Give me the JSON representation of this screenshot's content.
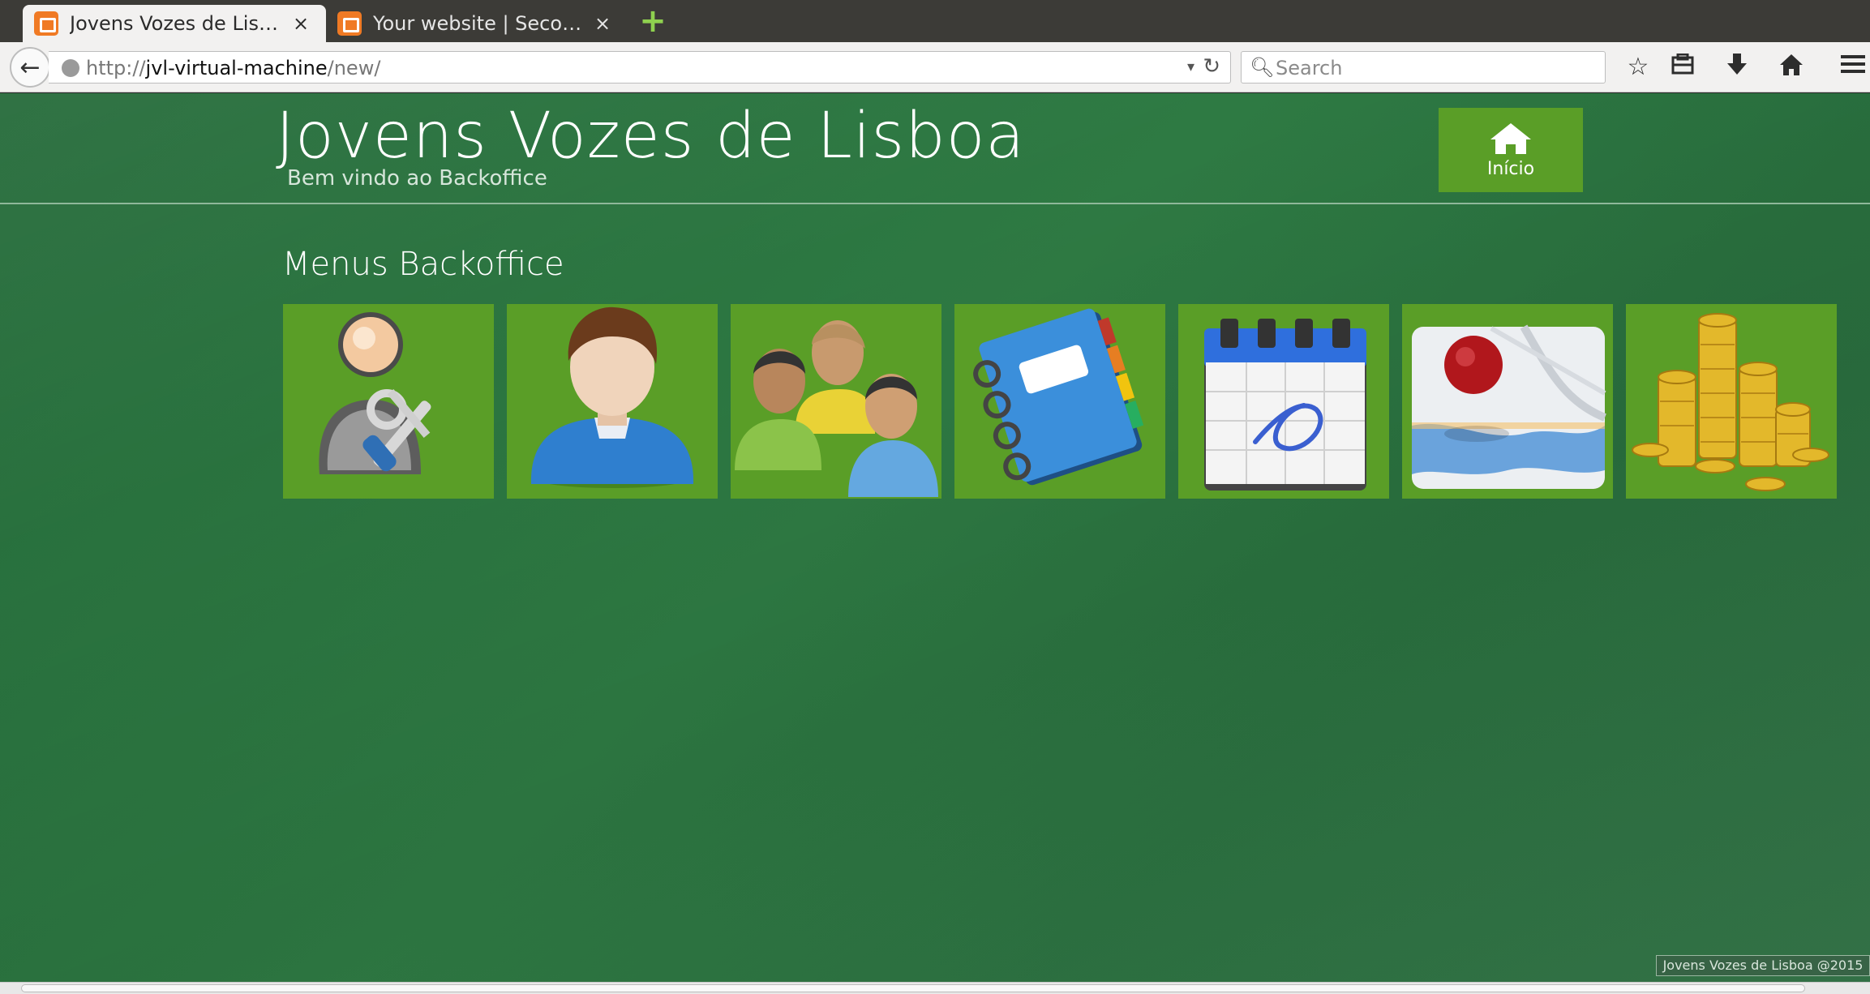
{
  "browser": {
    "tabs": [
      {
        "title": "Jovens Vozes de Lis…",
        "close": "×"
      },
      {
        "title": "Your website | Seco…",
        "close": "×"
      }
    ],
    "new_tab": "+",
    "url": {
      "scheme": "http://",
      "host": "jvl-virtual-machine",
      "path": "/new/"
    },
    "search_placeholder": "Search",
    "icons": [
      "back-icon",
      "globe-icon",
      "dropdown-icon",
      "reload-icon",
      "search-icon",
      "bookmark-star-icon",
      "reading-list-icon",
      "download-icon",
      "home-icon",
      "menu-icon"
    ]
  },
  "site": {
    "title": "Jovens Vozes de Lisboa",
    "subtitle": "Bem vindo ao Backoffice",
    "home_button": "Início",
    "section_title": "Menus Backoffice",
    "footer": "Jovens Vozes de Lisboa @2015"
  },
  "menu_tiles": [
    {
      "icon": "admin-tools-icon"
    },
    {
      "icon": "user-icon"
    },
    {
      "icon": "group-icon"
    },
    {
      "icon": "address-book-icon"
    },
    {
      "icon": "calendar-icon"
    },
    {
      "icon": "map-icon"
    },
    {
      "icon": "coins-icon"
    }
  ],
  "colors": {
    "page_green": "#2b7440",
    "tile_green": "#5a9e27",
    "tab_favicon": "#f07a24"
  }
}
